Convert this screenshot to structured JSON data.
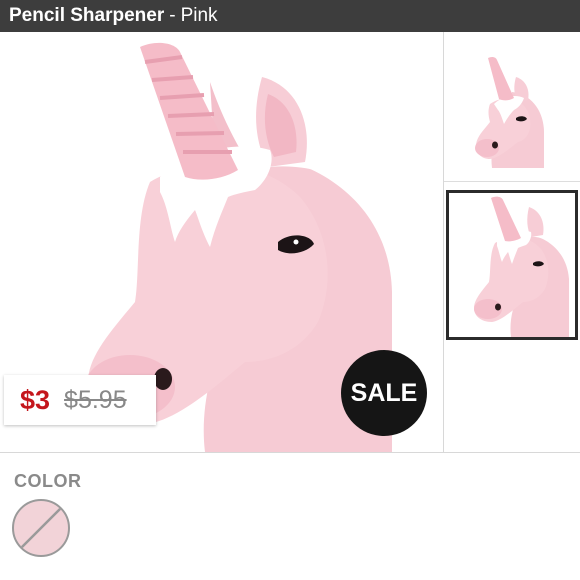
{
  "header": {
    "product_name": "Pencil Sharpener",
    "separator": "-",
    "variant": "Pink"
  },
  "gallery": {
    "main_image": "unicorn-pencil-sharpener-photo",
    "thumbnails": [
      {
        "name": "unicorn-front-view",
        "selected": false
      },
      {
        "name": "unicorn-side-view",
        "selected": true
      }
    ]
  },
  "pricing": {
    "sale_price": "$3",
    "original_price": "$5.95",
    "badge": "SALE"
  },
  "options": {
    "color_label": "COLOR",
    "swatches": [
      {
        "name": "pink",
        "color": "#f2d3d8",
        "selected": false
      }
    ]
  },
  "colors": {
    "header_bg": "#3d3d3d",
    "sale_red": "#c4161c",
    "badge_bg": "#151515",
    "unicorn_pink": "#f5c9d2"
  }
}
